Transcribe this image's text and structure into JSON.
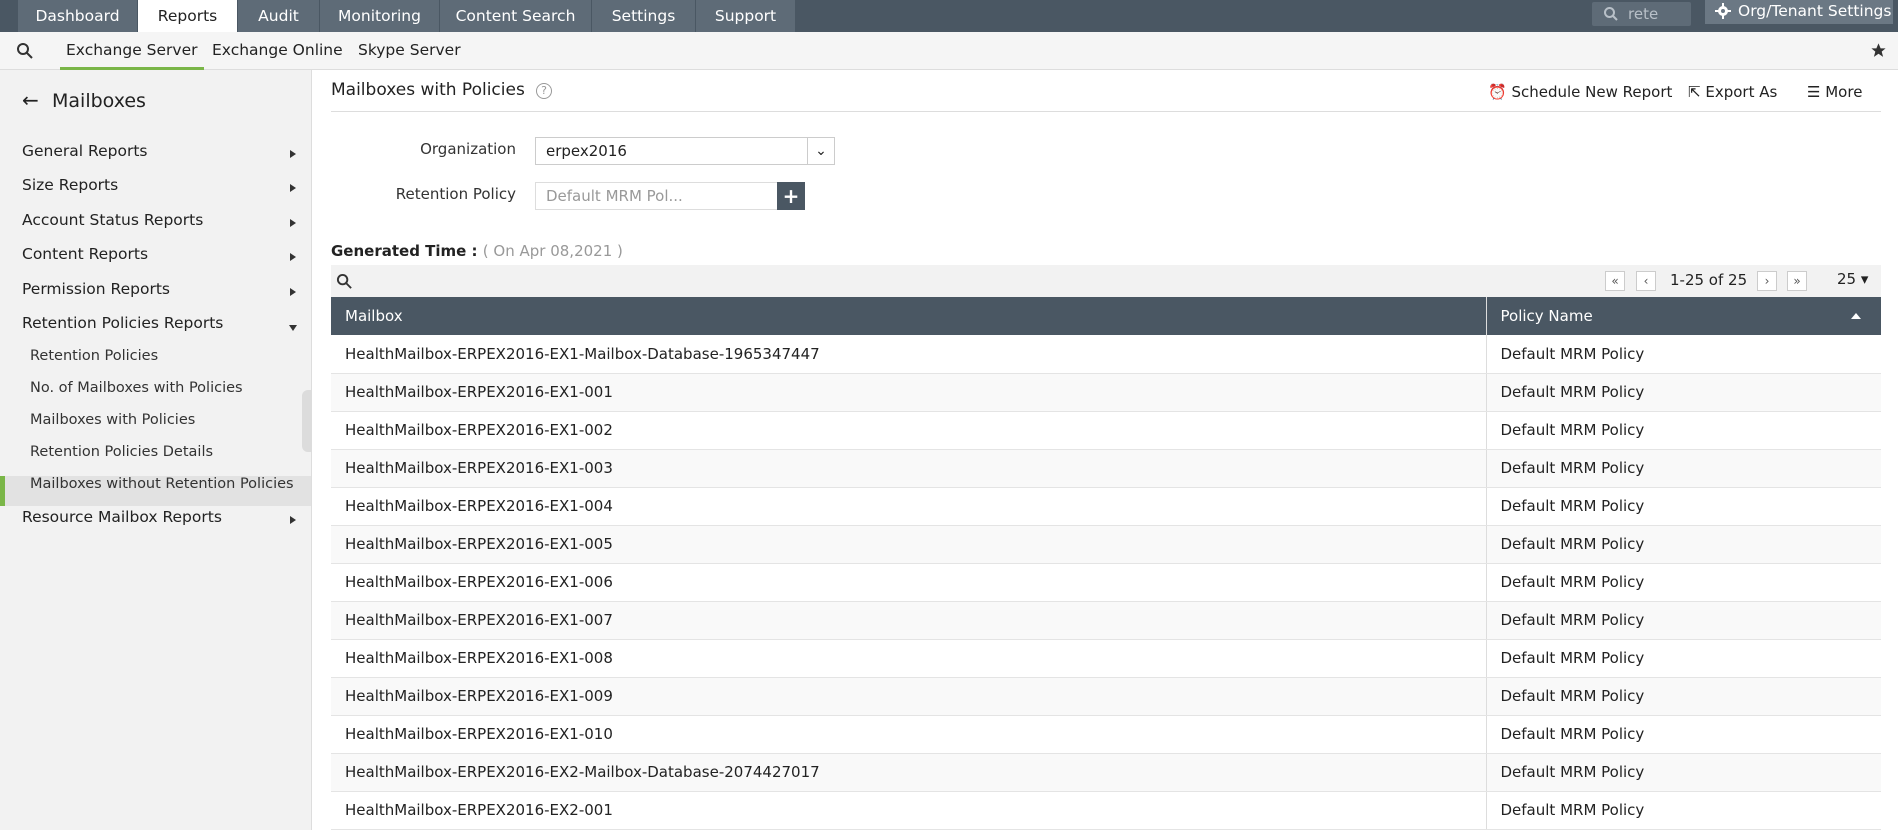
{
  "nav": {
    "tabs": [
      "Dashboard",
      "Reports",
      "Audit",
      "Monitoring",
      "Content Search",
      "Settings",
      "Support"
    ],
    "active": "Reports",
    "search_value": "rete",
    "org_settings": "Org/Tenant Settings"
  },
  "subnav": {
    "tabs": [
      "Exchange Server",
      "Exchange Online",
      "Skype Server"
    ],
    "active": "Exchange Server"
  },
  "sidebar": {
    "title": "Mailboxes",
    "groups": [
      "General Reports",
      "Size Reports",
      "Account Status Reports",
      "Content Reports",
      "Permission Reports",
      "Retention Policies Reports",
      "Resource Mailbox Reports"
    ],
    "sub_items": [
      "Retention Policies",
      "No. of Mailboxes with Policies",
      "Mailboxes with Policies",
      "Retention Policies Details",
      "Mailboxes without Retention Policies"
    ],
    "active_sub": "Mailboxes with Policies"
  },
  "page": {
    "title": "Mailboxes with Policies",
    "help": "?",
    "actions": {
      "schedule": "Schedule New Report",
      "export": "Export As",
      "more": "More"
    }
  },
  "filters": {
    "org_label": "Organization",
    "org_value": "erpex2016",
    "ret_label": "Retention Policy",
    "ret_placeholder": "Default MRM Pol..."
  },
  "generated": {
    "label": "Generated Time :",
    "value": "( On Apr 08,2021 )"
  },
  "pagination": {
    "info": "1-25 of 25",
    "page_size": "25"
  },
  "table": {
    "columns": [
      "Mailbox",
      "Policy Name"
    ],
    "rows": [
      [
        "HealthMailbox-ERPEX2016-EX1-Mailbox-Database-1965347447",
        "Default MRM Policy"
      ],
      [
        "HealthMailbox-ERPEX2016-EX1-001",
        "Default MRM Policy"
      ],
      [
        "HealthMailbox-ERPEX2016-EX1-002",
        "Default MRM Policy"
      ],
      [
        "HealthMailbox-ERPEX2016-EX1-003",
        "Default MRM Policy"
      ],
      [
        "HealthMailbox-ERPEX2016-EX1-004",
        "Default MRM Policy"
      ],
      [
        "HealthMailbox-ERPEX2016-EX1-005",
        "Default MRM Policy"
      ],
      [
        "HealthMailbox-ERPEX2016-EX1-006",
        "Default MRM Policy"
      ],
      [
        "HealthMailbox-ERPEX2016-EX1-007",
        "Default MRM Policy"
      ],
      [
        "HealthMailbox-ERPEX2016-EX1-008",
        "Default MRM Policy"
      ],
      [
        "HealthMailbox-ERPEX2016-EX1-009",
        "Default MRM Policy"
      ],
      [
        "HealthMailbox-ERPEX2016-EX1-010",
        "Default MRM Policy"
      ],
      [
        "HealthMailbox-ERPEX2016-EX2-Mailbox-Database-2074427017",
        "Default MRM Policy"
      ],
      [
        "HealthMailbox-ERPEX2016-EX2-001",
        "Default MRM Policy"
      ]
    ]
  },
  "colors": {
    "topbar": "#4a5763",
    "accent": "#7ab648"
  }
}
